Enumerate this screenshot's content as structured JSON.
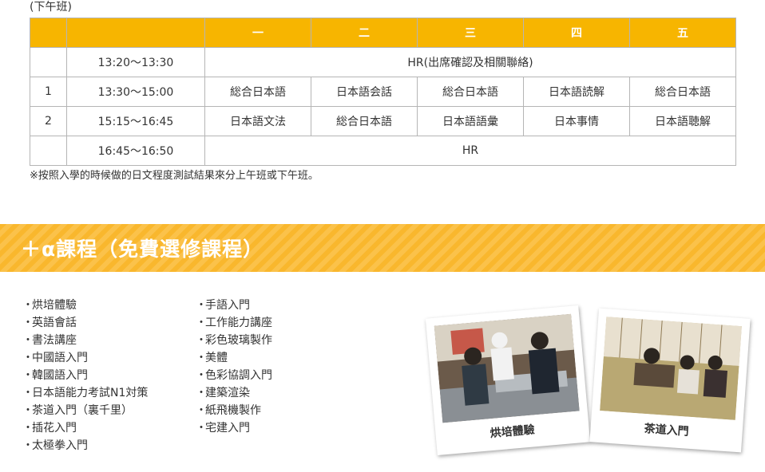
{
  "session_label": "(下午班)",
  "table": {
    "headers": [
      "",
      "",
      "一",
      "二",
      "三",
      "四",
      "五"
    ],
    "rows": [
      {
        "num": "",
        "time": "13:20～13:30",
        "span": "HR(出席確認及相關聯絡)"
      },
      {
        "num": "1",
        "time": "13:30～15:00",
        "cells": [
          "総合日本語",
          "日本語会話",
          "総合日本語",
          "日本語読解",
          "総合日本語"
        ]
      },
      {
        "num": "2",
        "time": "15:15～16:45",
        "cells": [
          "日本語文法",
          "総合日本語",
          "日本語語彙",
          "日本事情",
          "日本語聴解"
        ]
      },
      {
        "num": "",
        "time": "16:45～16:50",
        "span": "HR"
      }
    ]
  },
  "note": "※按照入學的時候做的日文程度測試結果來分上午班或下午班。",
  "banner": {
    "title": "＋α課程（免費選修課程）"
  },
  "courses": {
    "col1": [
      "烘培體驗",
      "英語會話",
      "書法講座",
      "中國語入門",
      "韓國語入門",
      "日本語能力考試N1対策",
      "茶道入門（裏千里）",
      "插花入門",
      "太極拳入門"
    ],
    "col2": [
      "手語入門",
      "工作能力講座",
      "彩色玻璃製作",
      "美體",
      "色彩協調入門",
      "建築渲染",
      "紙飛機製作",
      "宅建入門"
    ]
  },
  "photos": [
    {
      "caption": "烘培體驗"
    },
    {
      "caption": "茶道入門"
    }
  ],
  "colors": {
    "header_orange": "#f7b500",
    "banner_orange": "#f9b72d"
  }
}
